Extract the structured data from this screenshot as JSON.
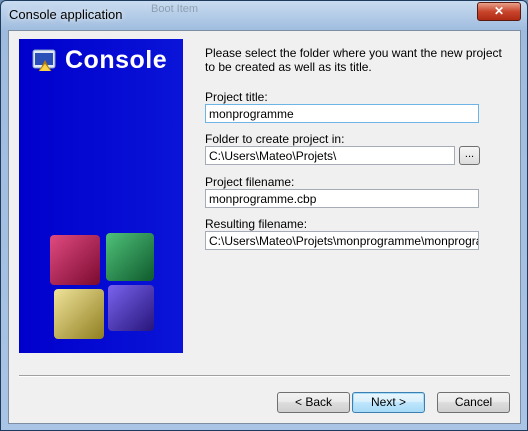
{
  "window": {
    "title": "Console application",
    "close_glyph": "✕",
    "background_title": "Boot Item"
  },
  "banner": {
    "title": "Console",
    "icon": "console-app-icon",
    "colors": {
      "background": "#0000cc",
      "cube_red": "#b01050",
      "cube_green": "#1f8a4a",
      "cube_yellow": "#c9b84a",
      "cube_purple": "#4a2fb8"
    }
  },
  "form": {
    "instructions": "Please select the folder where you want the new project to be created as well as its title.",
    "project_title": {
      "label": "Project title:",
      "value": "monprogramme"
    },
    "folder": {
      "label": "Folder to create project in:",
      "value": "C:\\Users\\Mateo\\Projets\\",
      "browse_label": "..."
    },
    "project_filename": {
      "label": "Project filename:",
      "value": "monprogramme.cbp"
    },
    "resulting_filename": {
      "label": "Resulting filename:",
      "value": "C:\\Users\\Mateo\\Projets\\monprogramme\\monprogramme"
    }
  },
  "buttons": {
    "back": "< Back",
    "next": "Next >",
    "cancel": "Cancel"
  }
}
